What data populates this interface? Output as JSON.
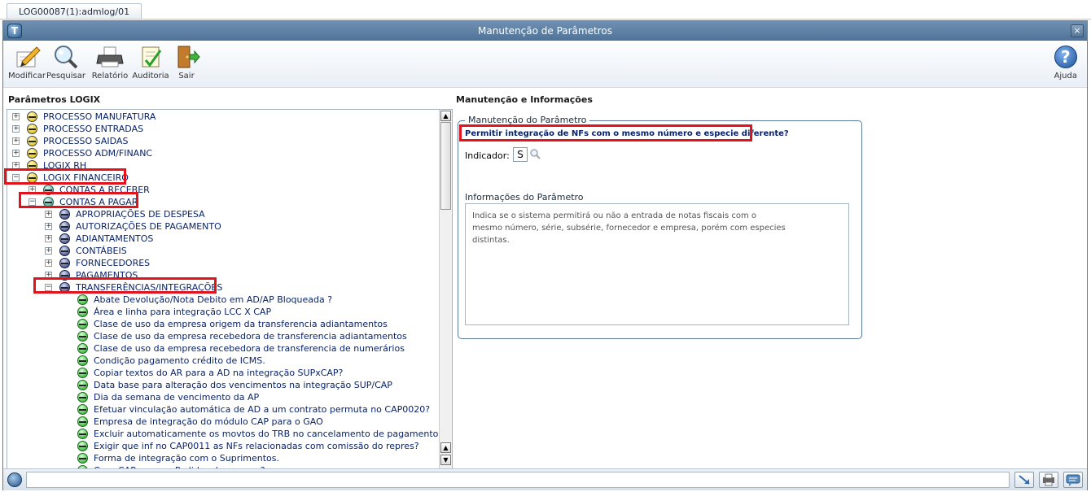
{
  "tab": {
    "label": "LOG00087(1):admlog/01"
  },
  "window": {
    "title": "Manutenção de Parâmetros",
    "close": "×",
    "logo": "T"
  },
  "toolbar": {
    "modificar": "Modificar",
    "pesquisar": "Pesquisar",
    "relatorio": "Relatório",
    "auditoria": "Auditoria",
    "sair": "Sair",
    "ajuda": "Ajuda",
    "help_glyph": "?"
  },
  "left": {
    "title": "Parâmetros LOGIX",
    "tree": [
      {
        "label": "PROCESSO MANUFATURA",
        "expander": "+",
        "icon": "yellow"
      },
      {
        "label": "PROCESSO ENTRADAS",
        "expander": "+",
        "icon": "yellow"
      },
      {
        "label": "PROCESSO SAIDAS",
        "expander": "+",
        "icon": "yellow"
      },
      {
        "label": "PROCESSO ADM/FINANC",
        "expander": "+",
        "icon": "yellow"
      },
      {
        "label": "LOGIX RH",
        "expander": "+",
        "icon": "yellow"
      },
      {
        "label": "LOGIX FINANCEIRO",
        "expander": "−",
        "icon": "yellow"
      },
      {
        "label": "CONTAS A RECEBER",
        "expander": "+",
        "icon": "teal"
      },
      {
        "label": "CONTAS A PAGAR",
        "expander": "−",
        "icon": "teal"
      },
      {
        "label": "APROPRIAÇÕES DE DESPESA",
        "expander": "+",
        "icon": "navy"
      },
      {
        "label": "AUTORIZAÇÕES DE PAGAMENTO",
        "expander": "+",
        "icon": "navy"
      },
      {
        "label": "ADIANTAMENTOS",
        "expander": "+",
        "icon": "navy"
      },
      {
        "label": "CONTÁBEIS",
        "expander": "+",
        "icon": "navy"
      },
      {
        "label": "FORNECEDORES",
        "expander": "+",
        "icon": "navy"
      },
      {
        "label": "PAGAMENTOS",
        "expander": "+",
        "icon": "navy"
      },
      {
        "label": "TRANSFERÊNCIAS/INTEGRAÇÕES",
        "expander": "−",
        "icon": "navy"
      },
      {
        "label": "Abate Devolução/Nota Debito em AD/AP Bloqueada ?",
        "icon": "green"
      },
      {
        "label": "Área e linha para integração LCC X CAP",
        "icon": "green"
      },
      {
        "label": "Clase de uso da empresa origem da transferencia adiantamentos",
        "icon": "green"
      },
      {
        "label": "Clase de uso da empresa recebedora de transferencia adiantamentos",
        "icon": "green"
      },
      {
        "label": "Clase de uso da empresa recebedora de transferencia de numerários",
        "icon": "green"
      },
      {
        "label": "Condição pagamento crédito de ICMS.",
        "icon": "green"
      },
      {
        "label": "Copiar textos do AR para a AD na integração SUPxCAP?",
        "icon": "green"
      },
      {
        "label": "Data base para alteração dos vencimentos na integração SUP/CAP",
        "icon": "green"
      },
      {
        "label": "Dia da semana de vencimento da AP",
        "icon": "green"
      },
      {
        "label": "Efetuar vinculação automática de AD a um contrato permuta no CAP0020?",
        "icon": "green"
      },
      {
        "label": "Empresa de integração do módulo CAP para o GAO",
        "icon": "green"
      },
      {
        "label": "Excluir automaticamente os movtos do TRB no cancelamento de pagamento?",
        "icon": "green"
      },
      {
        "label": "Exigir que inf no CAP0011 as NFs relacionadas com comissão do repres?",
        "icon": "green"
      },
      {
        "label": "Forma de integração com o Suprimentos.",
        "icon": "green"
      },
      {
        "label": "Gera CAP para os Pedidos de compra?",
        "icon": "green"
      }
    ]
  },
  "right": {
    "title": "Manutenção e Informações",
    "legend": "Manutenção do Parâmetro",
    "question": "Permitir integração de NFs com o mesmo número e especie diferente?",
    "indicator_label": "Indicador:",
    "indicator_value": "S",
    "info_label": "Informações do Parâmetro",
    "info_lines": [
      "Indica se o sistema permitirá ou não a entrada de notas fiscais com o",
      "mesmo número, série, subsérie, fornecedor e empresa, porém com especies",
      "distintas."
    ]
  },
  "colors": {
    "highlight": "#e2131b",
    "link_text": "#0a246a",
    "titlebar": "#5a7ea3"
  }
}
